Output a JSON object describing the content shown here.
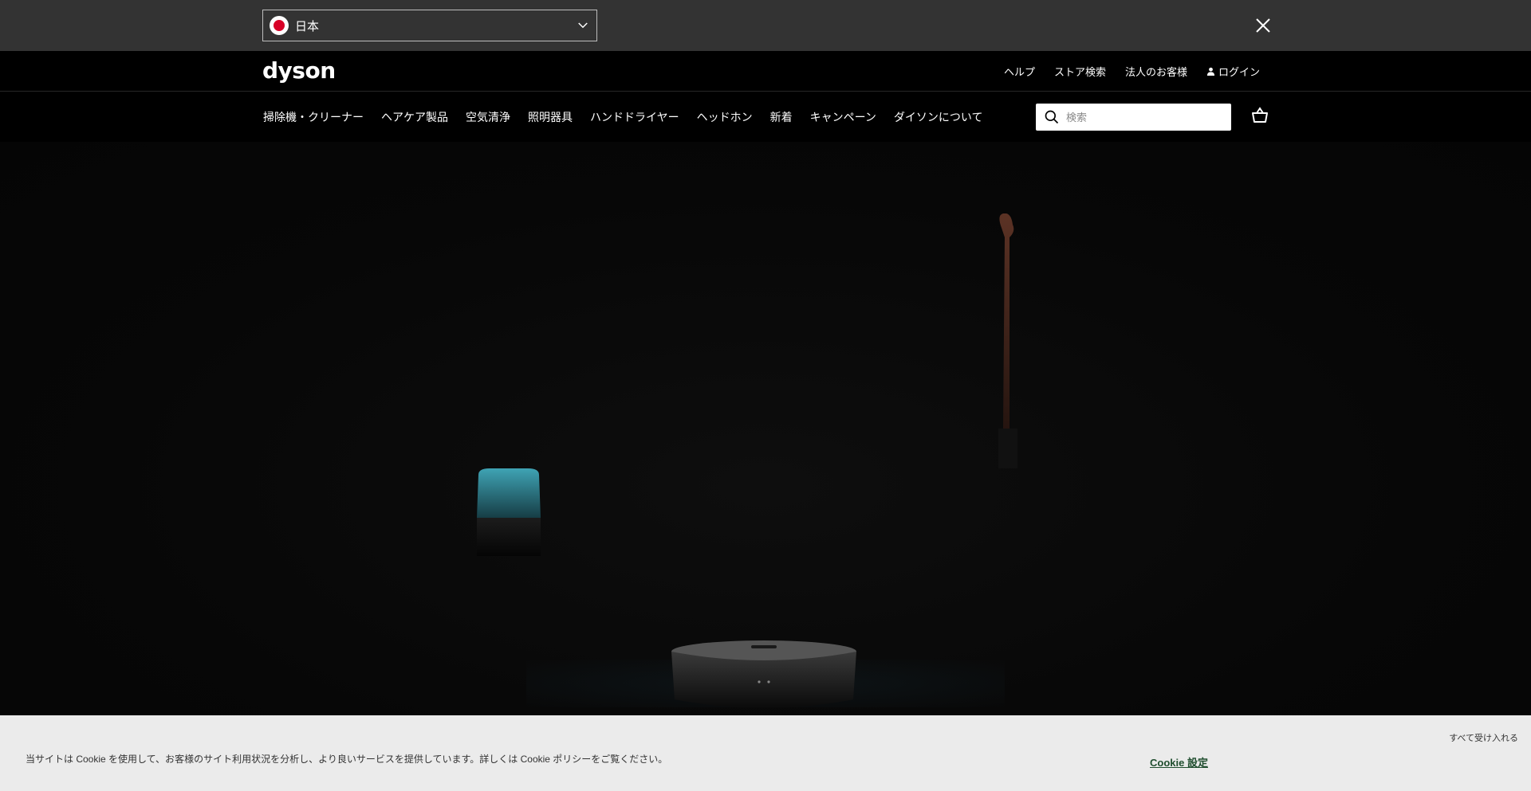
{
  "country_bar": {
    "selected_country": "日本",
    "flag_icon": "japan-flag-icon",
    "chevron_icon": "chevron-down-icon",
    "close_icon": "close-icon"
  },
  "header": {
    "logo_text": "dyson",
    "util_links": [
      "ヘルプ",
      "ストア検索",
      "法人のお客様"
    ],
    "account_label": "ログイン",
    "account_icon": "user-icon"
  },
  "nav": {
    "items": [
      "掃除機・クリーナー",
      "ヘアケア製品",
      "空気清浄",
      "照明器具",
      "ハンドドライヤー",
      "ヘッドホン",
      "新着",
      "キャンペーン",
      "ダイソンについて"
    ],
    "search_placeholder": "検索",
    "search_icon": "search-icon",
    "basket_icon": "basket-icon"
  },
  "hero": {
    "products": [
      "air-purifier",
      "stick-vacuum",
      "robot-vacuum"
    ]
  },
  "cookie": {
    "text": "当サイトは Cookie を使用して、お客様のサイト利用状況を分析し、より良いサービスを提供しています。詳しくは Cookie ポリシーをご覧ください。",
    "settings_label": "Cookie 設定",
    "close_label": "すべて受け入れる"
  },
  "colors": {
    "topbar": "#333333",
    "header": "#000000",
    "cookie_bg": "#ebebeb",
    "cookie_link": "#1f4d2e"
  }
}
